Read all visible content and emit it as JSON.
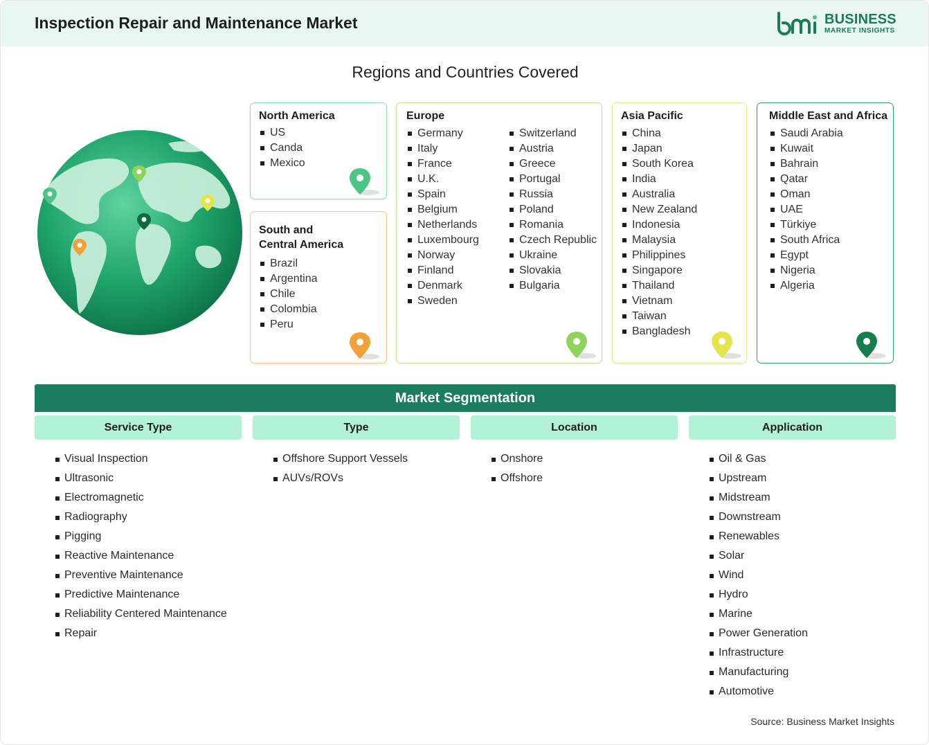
{
  "header": {
    "title": "Inspection Repair and Maintenance Market"
  },
  "logo": {
    "line1": "BUSINESS",
    "line2": "MARKET INSIGHTS",
    "color": "#1a7a5a"
  },
  "regions": {
    "title": "Regions and Countries Covered",
    "north_america": {
      "title": "North America",
      "items": [
        "US",
        "Canda",
        "Mexico"
      ],
      "color": "#4cc486"
    },
    "south_america": {
      "title_line1": "South and",
      "title_line2": "Central America",
      "items": [
        "Brazil",
        "Argentina",
        "Chile",
        "Colombia",
        "Peru"
      ],
      "color": "#f2a03a"
    },
    "europe": {
      "title": "Europe",
      "col1": [
        "Germany",
        "Italy",
        "France",
        "U.K.",
        "Spain",
        "Belgium",
        "Netherlands",
        "Luxembourg",
        "Norway",
        "Finland",
        "Denmark",
        "Sweden"
      ],
      "col2": [
        "Switzerland",
        "Austria",
        "Greece",
        "Portugal",
        "Russia",
        "Poland",
        "Romania",
        "Czech Republic",
        "Ukraine",
        "Slovakia",
        "Bulgaria"
      ],
      "color": "#8fd35a"
    },
    "asia_pacific": {
      "title": "Asia Pacific",
      "items": [
        "China",
        "Japan",
        "South Korea",
        "India",
        "Australia",
        "New Zealand",
        "Indonesia",
        "Malaysia",
        "Philippines",
        "Singapore",
        "Thailand",
        "Vietnam",
        "Taiwan",
        "Bangladesh"
      ],
      "color": "#e3e64a"
    },
    "mea": {
      "title": "Middle East and Africa",
      "items": [
        "Saudi Arabia",
        "Kuwait",
        "Bahrain",
        "Qatar",
        "Oman",
        "UAE",
        "Türkiye",
        "South Africa",
        "Egypt",
        "Nigeria",
        "Algeria"
      ],
      "color": "#1a7d4e"
    }
  },
  "segmentation": {
    "title": "Market Segmentation",
    "service_type": {
      "title": "Service Type",
      "items": [
        "Visual Inspection",
        "Ultrasonic",
        "Electromagnetic",
        "Radiography",
        "Pigging",
        "Reactive Maintenance",
        "Preventive Maintenance",
        "Predictive Maintenance",
        "Reliability Centered Maintenance",
        "Repair"
      ]
    },
    "type": {
      "title": "Type",
      "items": [
        "Offshore Support Vessels",
        "AUVs/ROVs"
      ]
    },
    "location": {
      "title": "Location",
      "items": [
        "Onshore",
        "Offshore"
      ]
    },
    "application": {
      "title": "Application",
      "items": [
        "Oil & Gas",
        "Upstream",
        "Midstream",
        "Downstream",
        "Renewables",
        "Solar",
        "Wind",
        "Hydro",
        "Marine",
        "Power Generation",
        "Infrastructure",
        "Manufacturing",
        "Automotive"
      ]
    }
  },
  "source": "Source: Business Market Insights",
  "colors": {
    "header_bg": "#e9f7ef",
    "segment_bar": "#1a7d5e",
    "segment_head": "#b2f2d6"
  }
}
